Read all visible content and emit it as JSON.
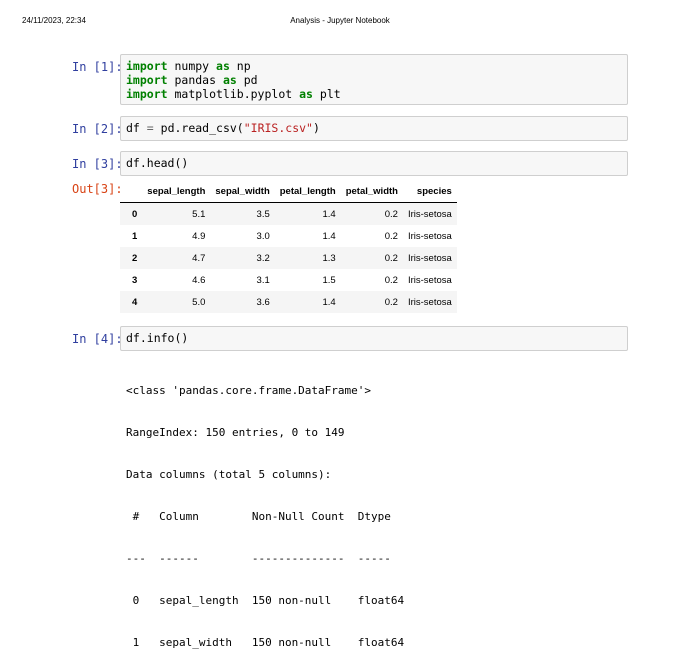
{
  "header": {
    "datetime": "24/11/2023, 22:34",
    "title": "Analysis - Jupyter Notebook"
  },
  "cells": [
    {
      "prompt": "In [1]:",
      "lines": [
        [
          {
            "t": "import",
            "c": "kw"
          },
          {
            "t": " numpy "
          },
          {
            "t": "as",
            "c": "kw"
          },
          {
            "t": " np"
          }
        ],
        [
          {
            "t": "import",
            "c": "kw"
          },
          {
            "t": " pandas "
          },
          {
            "t": "as",
            "c": "kw"
          },
          {
            "t": " pd"
          }
        ],
        [
          {
            "t": "import",
            "c": "kw"
          },
          {
            "t": " matplotlib.pyplot "
          },
          {
            "t": "as",
            "c": "kw"
          },
          {
            "t": " plt"
          }
        ]
      ]
    },
    {
      "prompt": "In [2]:",
      "lines": [
        [
          {
            "t": "df "
          },
          {
            "t": "=",
            "c": "op"
          },
          {
            "t": " pd.read_csv("
          },
          {
            "t": "\"IRIS.csv\"",
            "c": "str"
          },
          {
            "t": ")"
          }
        ]
      ]
    },
    {
      "prompt": "In [3]:",
      "lines": [
        [
          {
            "t": "df.head()"
          }
        ]
      ]
    },
    {
      "prompt": "In [4]:",
      "lines": [
        [
          {
            "t": "df.info()"
          }
        ]
      ]
    }
  ],
  "out3_prompt": "Out[3]:",
  "dataframe": {
    "columns": [
      "",
      "sepal_length",
      "sepal_width",
      "petal_length",
      "petal_width",
      "species"
    ],
    "rows": [
      [
        "0",
        "5.1",
        "3.5",
        "1.4",
        "0.2",
        "Iris-setosa"
      ],
      [
        "1",
        "4.9",
        "3.0",
        "1.4",
        "0.2",
        "Iris-setosa"
      ],
      [
        "2",
        "4.7",
        "3.2",
        "1.3",
        "0.2",
        "Iris-setosa"
      ],
      [
        "3",
        "4.6",
        "3.1",
        "1.5",
        "0.2",
        "Iris-setosa"
      ],
      [
        "4",
        "5.0",
        "3.6",
        "1.4",
        "0.2",
        "Iris-setosa"
      ]
    ]
  },
  "info_output": [
    "<class 'pandas.core.frame.DataFrame'>",
    "RangeIndex: 150 entries, 0 to 149",
    "Data columns (total 5 columns):",
    " #   Column        Non-Null Count  Dtype  ",
    "---  ------        --------------  -----  ",
    " 0   sepal_length  150 non-null    float64",
    " 1   sepal_width   150 non-null    float64"
  ]
}
